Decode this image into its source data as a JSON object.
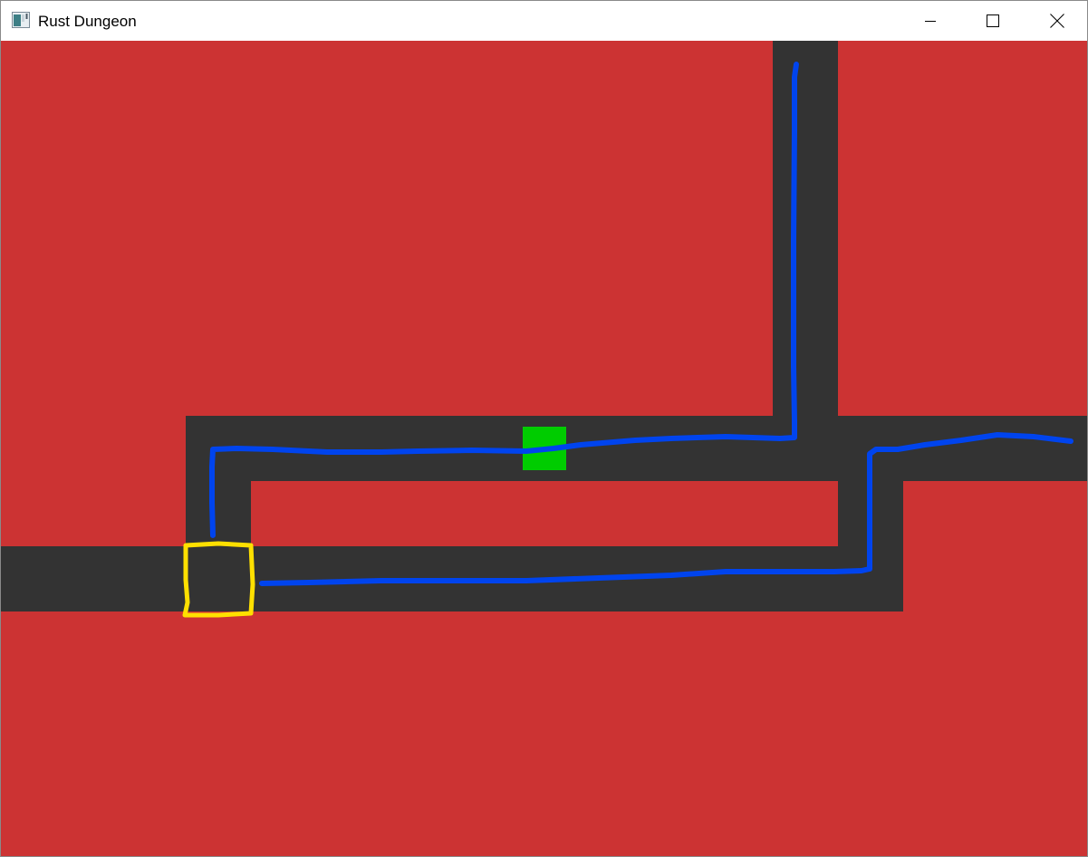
{
  "window": {
    "title": "Rust Dungeon",
    "icon": "app-window-icon",
    "controls": {
      "minimize": "minimize-icon",
      "maximize": "maximize-icon",
      "close": "close-icon"
    }
  },
  "scene": {
    "wall_color": "#cc3333",
    "floor_color": "#333333",
    "player_color": "#00cc00",
    "path_annotation_color": "#0044ee",
    "marker_annotation_color": "#ffe000"
  }
}
